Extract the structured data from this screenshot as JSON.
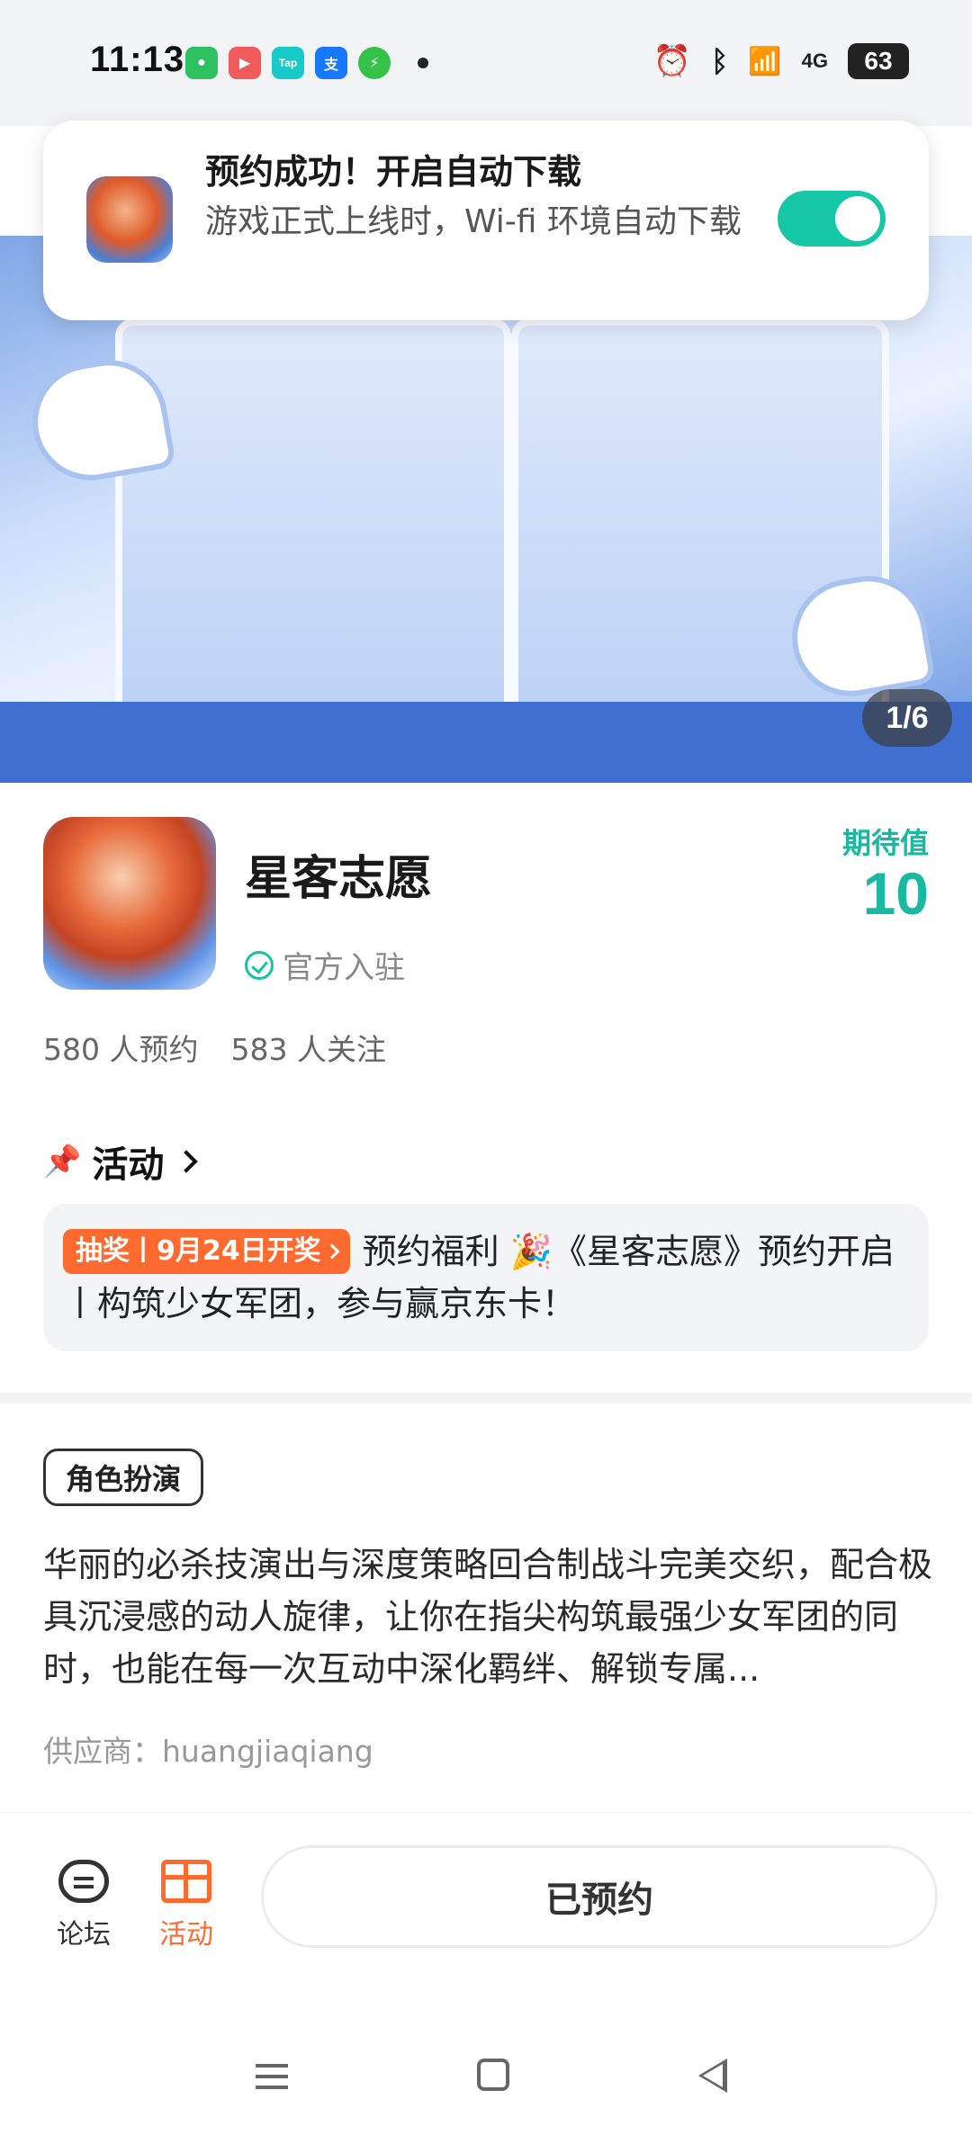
{
  "status_bar": {
    "time": "11:13",
    "network": "4G",
    "battery": "63",
    "apps": [
      {
        "icon": "wechat-icon",
        "color": "#2dc160",
        "glyph": "●"
      },
      {
        "icon": "video-icon",
        "color": "#f05a5a",
        "glyph": "▶"
      },
      {
        "icon": "taptap-icon",
        "color": "#18c9c9",
        "glyph": "Tap"
      },
      {
        "icon": "alipay-icon",
        "color": "#1677ff",
        "glyph": "支"
      },
      {
        "icon": "security-icon",
        "color": "#35c24a",
        "glyph": "⚡"
      }
    ]
  },
  "toast": {
    "title": "预约成功！开启自动下载",
    "subtitle": "游戏正式上线时，Wi-fi 环境自动下载",
    "toggle_on": true,
    "accent": "#16c7a7"
  },
  "hero": {
    "counter": "1/6"
  },
  "game": {
    "name": "星客志愿",
    "verified_label": "官方入驻",
    "expect_label": "期待值",
    "expect_value": "10",
    "stats": {
      "reservations": "580 人预约",
      "followers": "583 人关注"
    }
  },
  "activity": {
    "title": "活动",
    "badge": "抽奖丨9月24日开奖",
    "text": "预约福利 🎉《星客志愿》预约开启丨构筑少女军团，参与赢京东卡！",
    "badge_color": "#ff6a2f"
  },
  "description": {
    "tag": "角色扮演",
    "text": "华丽的必杀技演出与深度策略回合制战斗完美交织，配合极具沉浸感的动人旋律，让你在指尖构筑最强少女军团的同时，也能在每一次互动中深化羁绊、解锁专属...",
    "supplier": "供应商：huangjiaqiang"
  },
  "bottom_bar": {
    "forum_label": "论坛",
    "activity_label": "活动",
    "reserve_button": "已预约"
  }
}
